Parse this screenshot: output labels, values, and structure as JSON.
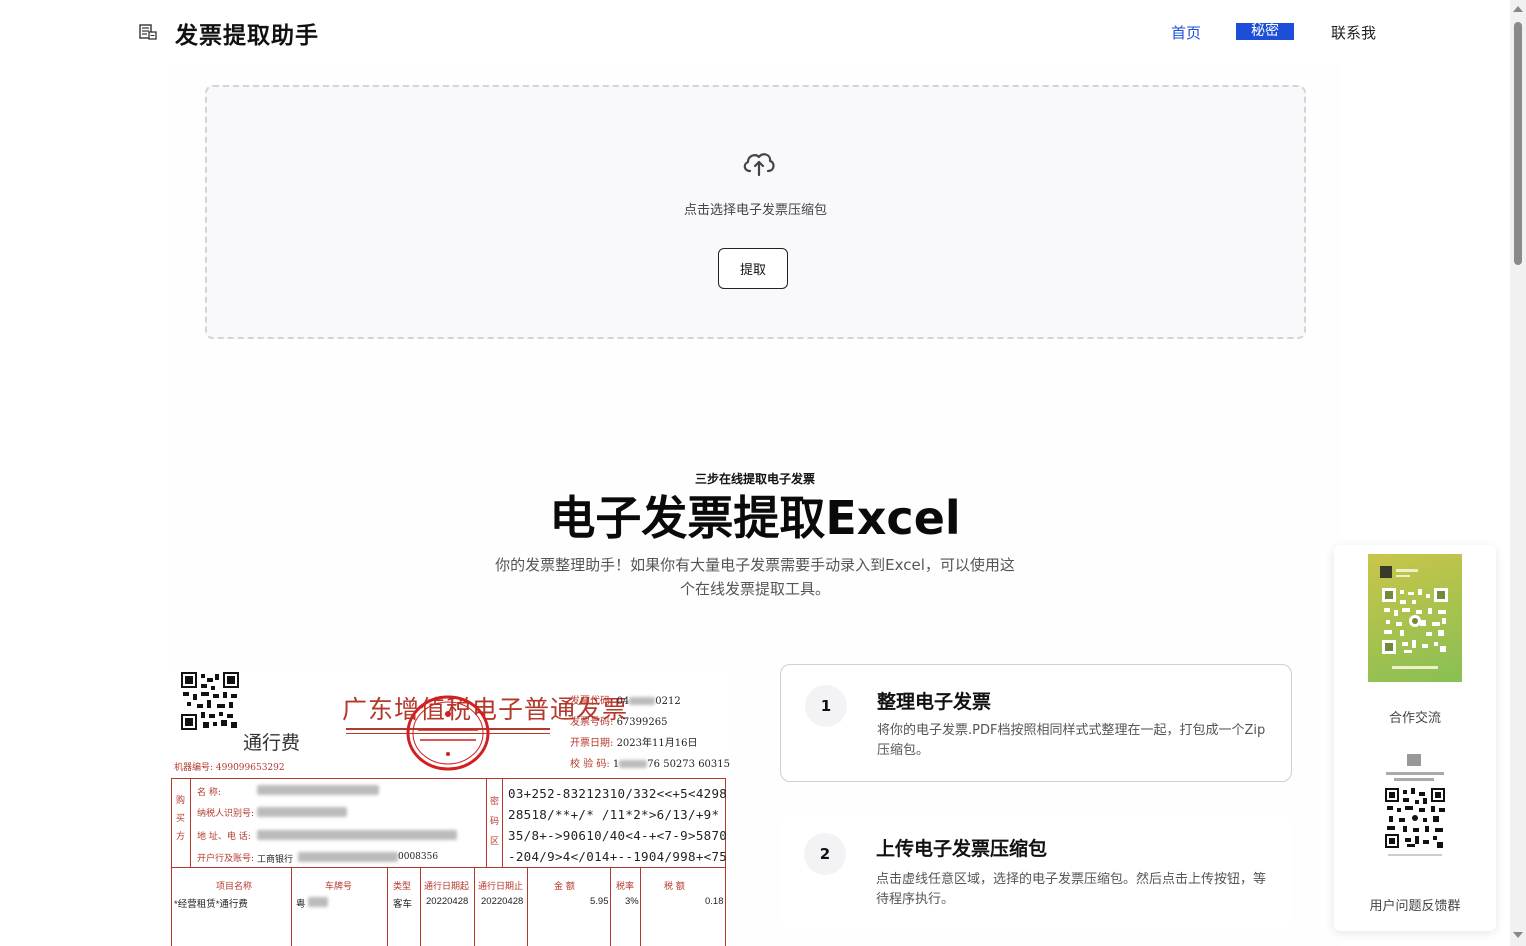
{
  "header": {
    "brand": "发票提取助手",
    "nav": {
      "home": "首页",
      "secret": "秘密",
      "contact": "联系我"
    }
  },
  "upload": {
    "hint": "点击选择电子发票压缩包",
    "button": "提取"
  },
  "hero": {
    "eyebrow": "三步在线提取电子发票",
    "title": "电子发票提取Excel",
    "description": "你的发票整理助手！如果你有大量电子发票需要手动录入到Excel，可以使用这个在线发票提取工具。"
  },
  "invoice": {
    "title": "广东增值税电子普通发票",
    "item_type": "通行费",
    "machine_no": "机器编号:  499099653292",
    "meta": {
      "code_label": "发票代码:",
      "code_value": "04",
      "code_value_end": "0212",
      "number_label": "发票号码:",
      "number_value": "67399265",
      "date_label": "开票日期:",
      "date_value": "2023年11月16日",
      "check_label": "校 验 码:",
      "check_value_start": "1",
      "check_value_end": "76 50273 60315"
    },
    "buyer_side": "购买方",
    "buyer_fields": [
      "名          称:",
      "纳税人识别号:",
      "地 址、电 话:",
      "开户行及账号:"
    ],
    "buyer_bank_prefix": "工商银行",
    "buyer_account_end": "0008356",
    "secret_side": "密码区",
    "secret_codes": [
      "03+252-83212310/332<<+5<4298",
      "28518/**+/*   /11*2*>6/13/+9*",
      "35/8+->90610/40<4-+<7-9>5870",
      "-204/9>4</014+--1904/998+<75"
    ],
    "columns": [
      "项目名称",
      "车牌号",
      "类型",
      "通行日期起",
      "通行日期止",
      "金  额",
      "税率",
      "税  额"
    ],
    "row": {
      "name": "*经营租赁*通行费",
      "plate": "粤",
      "type": "客车",
      "start": "20220428",
      "end": "20220428",
      "amount": "5.95",
      "rate": "3%",
      "tax": "0.18"
    }
  },
  "steps": [
    {
      "num": "1",
      "title": "整理电子发票",
      "text": "将你的电子发票.PDF档按照相同样式式整理在一起，打包成一个Zip压缩包。"
    },
    {
      "num": "2",
      "title": "上传电子发票压缩包",
      "text": "点击虚线任意区域，选择的电子发票压缩包。然后点击上传按钮，等待程序执行。"
    }
  ],
  "side": {
    "coop_label": "合作交流",
    "feedback_label": "用户问题反馈群"
  },
  "colors": {
    "accent": "#1d4ed8",
    "invoice_red": "#b3392c"
  }
}
